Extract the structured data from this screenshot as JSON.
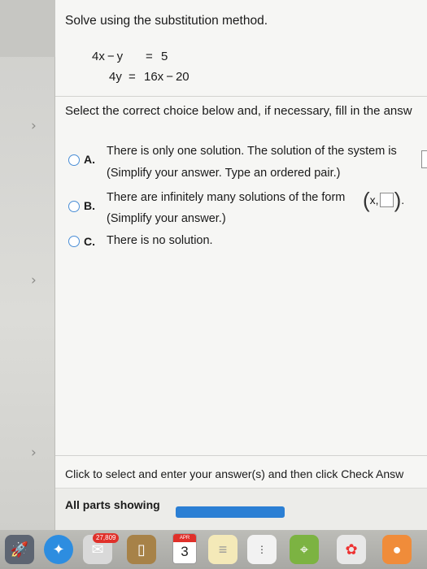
{
  "problem": {
    "title": "Solve using the substitution method.",
    "equation1": {
      "left": "4x − y",
      "eq": "=",
      "right": "5"
    },
    "equation2": {
      "left": "4y",
      "eq": "=",
      "right": "16x − 20"
    }
  },
  "instruction": "Select the correct choice below and, if necessary, fill in the answ",
  "options": [
    {
      "letter": "A.",
      "line1": "There is only one solution. The solution of the system is",
      "line2": "(Simplify your answer. Type an ordered pair.)"
    },
    {
      "letter": "B.",
      "line1": "There are infinitely many solutions of the form",
      "form_prefix": "x,",
      "line2": "(Simplify your answer.)"
    },
    {
      "letter": "C.",
      "line1": "There is no solution."
    }
  ],
  "footer": {
    "hint": "Click to select and enter your answer(s) and then click Check Answ",
    "parts_label": "All parts showing"
  },
  "dock": {
    "badge": "27,809",
    "calendar_month": "APR",
    "calendar_day": "3"
  },
  "colors": {
    "accent": "#2b7fd4",
    "radio_border": "#4a8ed6"
  }
}
